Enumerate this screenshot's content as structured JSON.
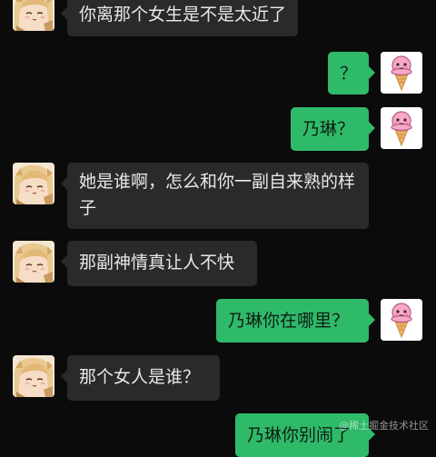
{
  "colors": {
    "background": "#0b0b0b",
    "incoming_bubble": "#2a2a2a",
    "outgoing_bubble": "#2fba6a",
    "incoming_text": "#e8e8e8",
    "outgoing_text": "#0f1f14"
  },
  "avatars": {
    "incoming": "anime-girl-avatar",
    "outgoing": "ice-cream-cone-avatar"
  },
  "messages": [
    {
      "side": "left",
      "text": "你离那个女生是不是太近了"
    },
    {
      "side": "right",
      "text": "？"
    },
    {
      "side": "right",
      "text": "乃琳？"
    },
    {
      "side": "left",
      "text": "她是谁啊，怎么和你一副自来熟的样子"
    },
    {
      "side": "left",
      "text": "那副神情真让人不快"
    },
    {
      "side": "right",
      "text": "乃琳你在哪里？"
    },
    {
      "side": "left",
      "text": "那个女人是谁？"
    },
    {
      "side": "right",
      "text": "乃琳你别闹了"
    }
  ],
  "watermark": "@稀土掘金技术社区"
}
